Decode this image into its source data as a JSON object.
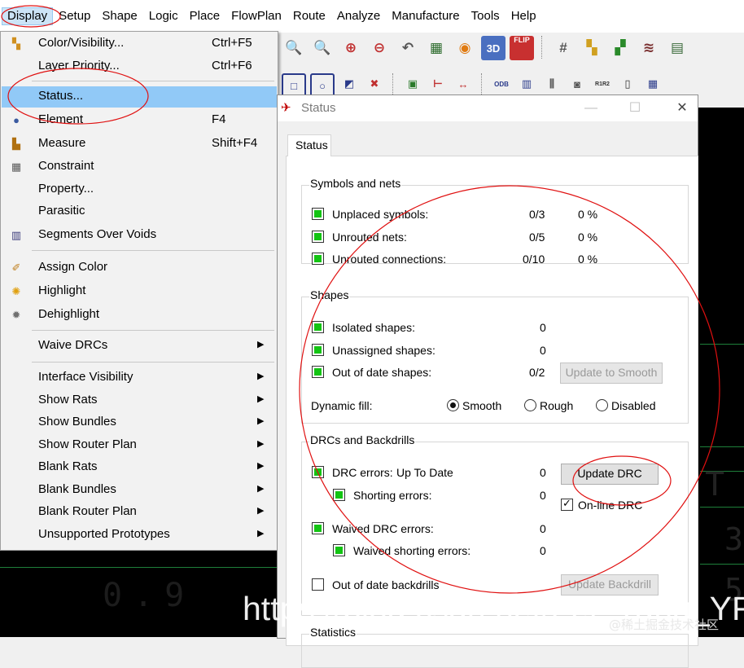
{
  "menubar": {
    "items": [
      "Display",
      "Setup",
      "Shape",
      "Logic",
      "Place",
      "FlowPlan",
      "Route",
      "Analyze",
      "Manufacture",
      "Tools",
      "Help"
    ]
  },
  "display_menu": {
    "items": [
      {
        "label": "Color/Visibility...",
        "shortcut": "Ctrl+F5",
        "icon": "color-visibility-icon",
        "submenu": false
      },
      {
        "label": "Layer Priority...",
        "shortcut": "Ctrl+F6",
        "icon": "",
        "submenu": false
      },
      {
        "label": "Status...",
        "shortcut": "",
        "icon": "",
        "submenu": false,
        "highlighted": true
      },
      {
        "label": "Element",
        "shortcut": "F4",
        "icon": "element-info-icon",
        "submenu": false
      },
      {
        "label": "Measure",
        "shortcut": "Shift+F4",
        "icon": "measure-icon",
        "submenu": false
      },
      {
        "label": "Constraint",
        "shortcut": "",
        "icon": "constraint-icon",
        "submenu": false
      },
      {
        "label": "Property...",
        "shortcut": "",
        "icon": "",
        "submenu": false
      },
      {
        "label": "Parasitic",
        "shortcut": "",
        "icon": "",
        "submenu": false
      },
      {
        "label": "Segments Over Voids",
        "shortcut": "",
        "icon": "segments-over-voids-icon",
        "submenu": false
      },
      {
        "label": "Assign Color",
        "shortcut": "",
        "icon": "assign-color-icon",
        "submenu": false
      },
      {
        "label": "Highlight",
        "shortcut": "",
        "icon": "highlight-icon",
        "submenu": false
      },
      {
        "label": "Dehighlight",
        "shortcut": "",
        "icon": "dehighlight-icon",
        "submenu": false
      },
      {
        "label": "Waive DRCs",
        "shortcut": "",
        "icon": "",
        "submenu": true
      },
      {
        "label": "Interface Visibility",
        "shortcut": "",
        "icon": "",
        "submenu": true
      },
      {
        "label": "Show Rats",
        "shortcut": "",
        "icon": "",
        "submenu": true
      },
      {
        "label": "Show Bundles",
        "shortcut": "",
        "icon": "",
        "submenu": true
      },
      {
        "label": "Show Router Plan",
        "shortcut": "",
        "icon": "",
        "submenu": true
      },
      {
        "label": "Blank Rats",
        "shortcut": "",
        "icon": "",
        "submenu": true
      },
      {
        "label": "Blank Bundles",
        "shortcut": "",
        "icon": "",
        "submenu": true
      },
      {
        "label": "Blank Router Plan",
        "shortcut": "",
        "icon": "",
        "submenu": true
      },
      {
        "label": "Unsupported Prototypes",
        "shortcut": "",
        "icon": "",
        "submenu": true
      }
    ]
  },
  "toolbar": {
    "flip_label": "FLIP",
    "three_d_label": "3D",
    "odb_label": "ODB",
    "refdes_label": "R1R2"
  },
  "dialog": {
    "title": "Status",
    "tab_label": "Status",
    "symbols_group": {
      "title": "Symbols and nets",
      "rows": [
        {
          "label": "Unplaced symbols:",
          "count": "0/3",
          "percent": "0 %"
        },
        {
          "label": "Unrouted nets:",
          "count": "0/5",
          "percent": "0 %"
        },
        {
          "label": "Unrouted connections:",
          "count": "0/10",
          "percent": "0 %"
        }
      ]
    },
    "shapes_group": {
      "title": "Shapes",
      "rows": [
        {
          "label": "Isolated shapes:",
          "count": "0"
        },
        {
          "label": "Unassigned shapes:",
          "count": "0"
        },
        {
          "label": "Out of date shapes:",
          "count": "0/2"
        }
      ],
      "update_smooth_label": "Update to Smooth",
      "dynamic_fill_label": "Dynamic fill:",
      "fill_options": [
        "Smooth",
        "Rough",
        "Disabled"
      ],
      "fill_selected": "Smooth"
    },
    "drc_group": {
      "title": "DRCs and Backdrills",
      "drc_errors_label": "DRC errors:",
      "drc_status": "Up To Date",
      "drc_count": "0",
      "update_drc_label": "Update DRC",
      "shorting_label": "Shorting errors:",
      "shorting_count": "0",
      "online_drc_label": "On-line DRC",
      "online_drc_checked": true,
      "waived_label": "Waived DRC errors:",
      "waived_count": "0",
      "waived_shorting_label": "Waived shorting errors:",
      "waived_shorting_count": "0",
      "backdrills_label": "Out of date backdrills",
      "update_backdrill_label": "Update Backdrill"
    },
    "statistics_title": "Statistics"
  },
  "canvas_text": {
    "left_value": "0.9",
    "right_digit_1": "3",
    "right_digit_2": "5",
    "right_partial": "T"
  },
  "watermark": {
    "main": "https://blog.csdn.net/Fei_Yang_YF",
    "sub": "@稀土掘金技术社区"
  },
  "colors": {
    "menu_highlight": "#91c9f7",
    "status_green": "#13c413",
    "annotation_red": "#e01010",
    "canvas_bg": "#000000"
  }
}
